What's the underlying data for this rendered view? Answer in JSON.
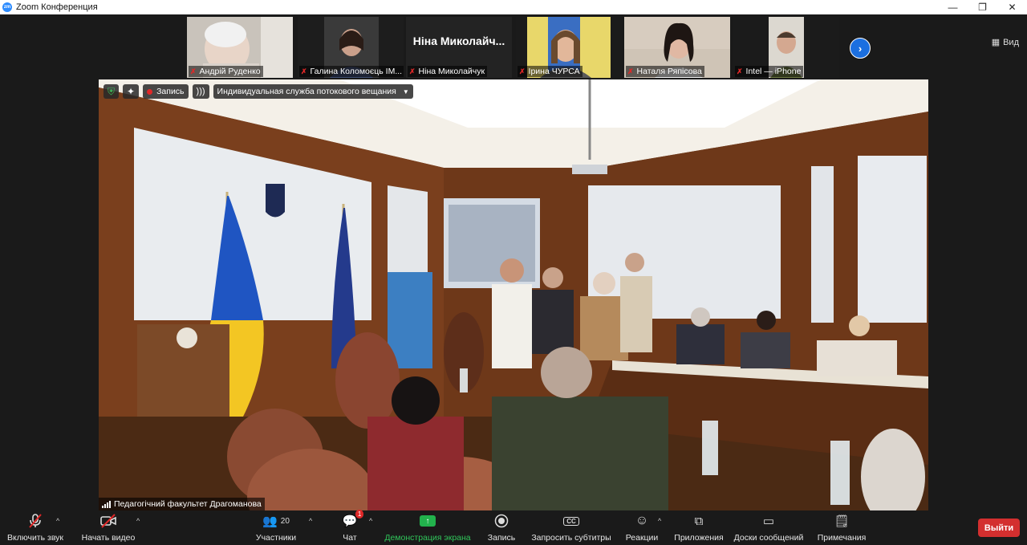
{
  "window": {
    "title": "Zoom Конференция",
    "logo_text": "zm",
    "controls": [
      "—",
      "❐",
      "✕"
    ]
  },
  "participants_strip": {
    "view_label": "Вид",
    "items": [
      {
        "name": "Андрій Руденко",
        "muted": true,
        "type": "video"
      },
      {
        "name": "Галина Коломоєць ІМ...",
        "muted": true,
        "type": "video"
      },
      {
        "name": "Ніна Миколайчук",
        "muted": true,
        "type": "name",
        "display_name": "Ніна Миколайч..."
      },
      {
        "name": "Ірина ЧУРСА",
        "muted": true,
        "type": "video"
      },
      {
        "name": "Наталя Ряпісова",
        "muted": true,
        "type": "video"
      },
      {
        "name": "Intel — iPhone",
        "muted": true,
        "type": "video"
      }
    ]
  },
  "main_video": {
    "top_bar": {
      "record_label": "Запись",
      "stream_label": "Индивидуальная служба потокового вещания"
    },
    "speaker_name": "Педагогічний факультет Драгоманова"
  },
  "toolbar": {
    "unmute_label": "Включить звук",
    "start_video_label": "Начать видео",
    "participants_label": "Участники",
    "participants_count": "20",
    "chat_label": "Чат",
    "chat_badge": "1",
    "share_label": "Демонстрация экрана",
    "record_label": "Запись",
    "captions_label": "Запросить субтитры",
    "reactions_label": "Реакции",
    "apps_label": "Приложения",
    "whiteboards_label": "Доски сообщений",
    "notes_label": "Примечания",
    "exit_label": "Выйти"
  }
}
